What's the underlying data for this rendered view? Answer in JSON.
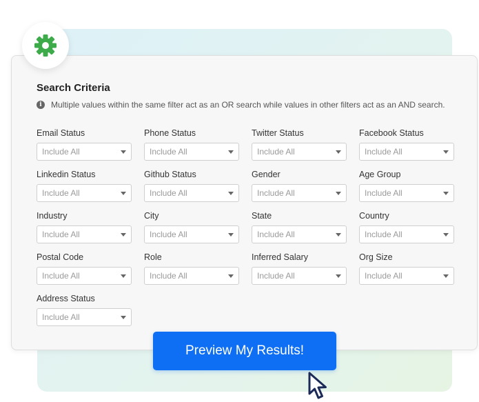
{
  "card": {
    "title": "Search Criteria",
    "info": "Multiple values within the same filter act as an OR search while values in other filters act as an AND search."
  },
  "filters": [
    {
      "label": "Email Status",
      "value": "Include All"
    },
    {
      "label": "Phone Status",
      "value": "Include All"
    },
    {
      "label": "Twitter Status",
      "value": "Include All"
    },
    {
      "label": "Facebook Status",
      "value": "Include All"
    },
    {
      "label": "Linkedin Status",
      "value": "Include All"
    },
    {
      "label": "Github Status",
      "value": "Include All"
    },
    {
      "label": "Gender",
      "value": "Include All"
    },
    {
      "label": "Age Group",
      "value": "Include All"
    },
    {
      "label": "Industry",
      "value": "Include All"
    },
    {
      "label": "City",
      "value": "Include All"
    },
    {
      "label": "State",
      "value": "Include All"
    },
    {
      "label": "Country",
      "value": "Include All"
    },
    {
      "label": "Postal Code",
      "value": "Include All"
    },
    {
      "label": "Role",
      "value": "Include All"
    },
    {
      "label": "Inferred Salary",
      "value": "Include All"
    },
    {
      "label": "Org Size",
      "value": "Include All"
    },
    {
      "label": "Address Status",
      "value": "Include All"
    }
  ],
  "cta": {
    "label": "Preview My Results!"
  },
  "colors": {
    "accent": "#0f6ff4",
    "gear": "#3dab4a"
  }
}
